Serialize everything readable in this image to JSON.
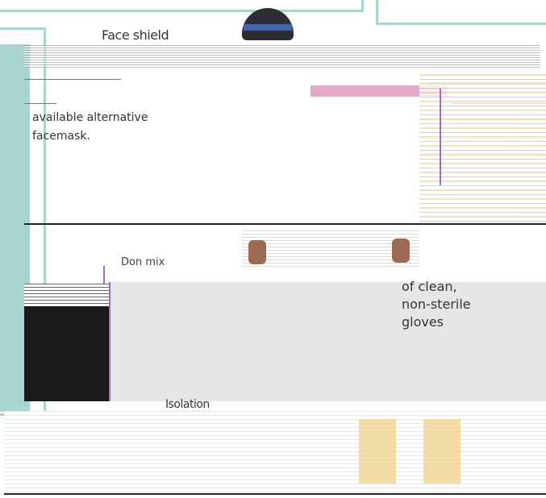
{
  "header": {
    "top_label": "Face shield"
  },
  "left_column": {
    "lines": [
      "available alternative",
      "facemask."
    ]
  },
  "right_column": {
    "glove_lines": [
      "of clean,",
      "non-sterile",
      "gloves"
    ]
  },
  "middle": {
    "dont_label": "Don mix"
  },
  "footer": {
    "isolation_label": "Isolation"
  },
  "colors": {
    "teal": "#a8d5cf",
    "skin": "#9d6b53",
    "band": "#3f66b0",
    "accent_purple": "#a06bc9",
    "gown_pink": "#e4a9c8"
  }
}
